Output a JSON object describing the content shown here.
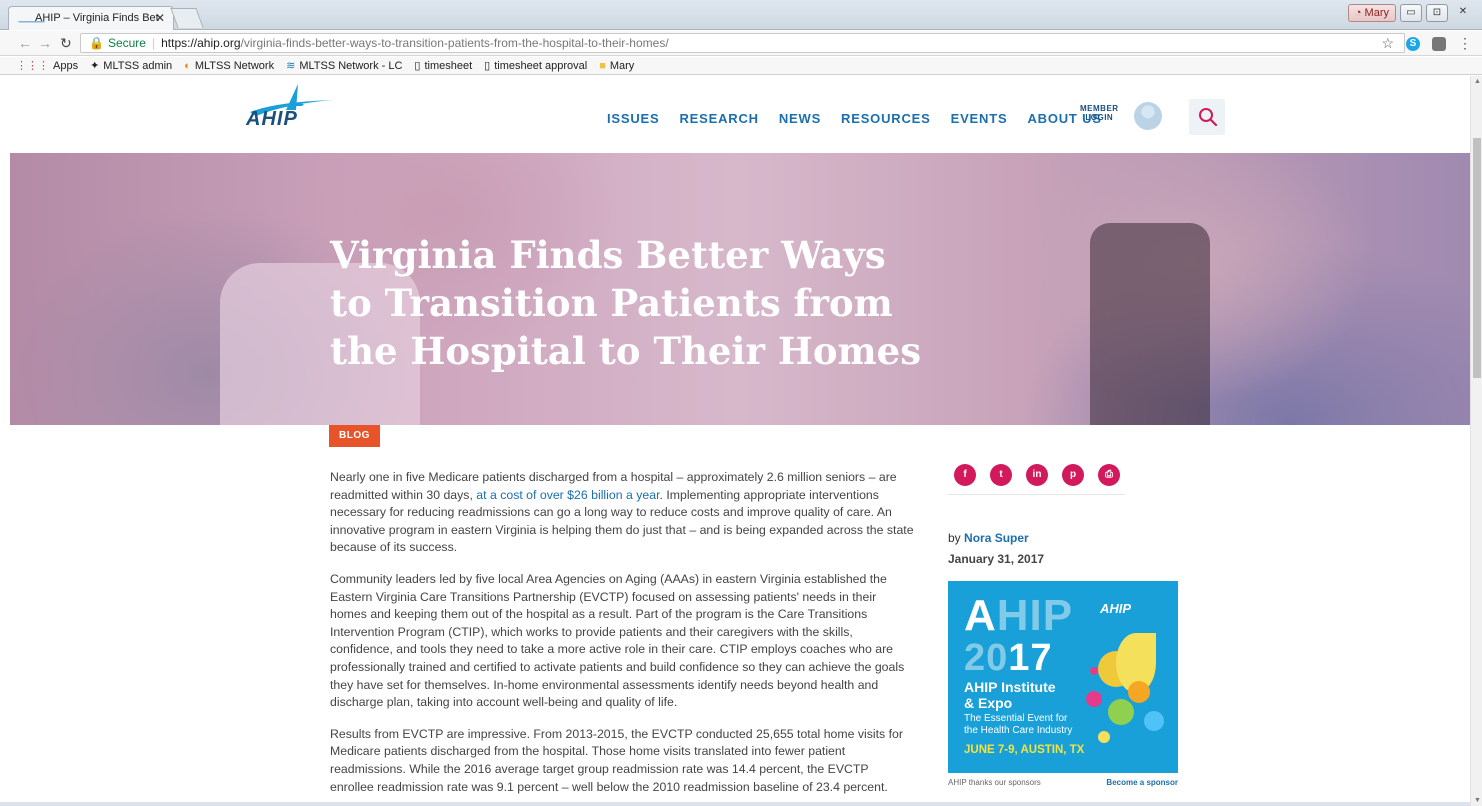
{
  "browser": {
    "tab_title": "AHIP – Virginia Finds Bet",
    "tab_close": "✕",
    "user_badge": "Mary",
    "win_min": "▭",
    "win_max": "⊡",
    "win_close": "✕",
    "secure_label": "Secure",
    "url_host": "https://ahip.org",
    "url_path": "/virginia-finds-better-ways-to-transition-patients-from-the-hospital-to-their-homes/",
    "bookmarks": [
      {
        "label": "Apps",
        "icon": "apps-grid-icon"
      },
      {
        "label": "MLTSS admin",
        "icon": "mltss-icon"
      },
      {
        "label": "MLTSS Network",
        "icon": "network-icon"
      },
      {
        "label": "MLTSS Network - LC",
        "icon": "network-icon"
      },
      {
        "label": "timesheet",
        "icon": "page-icon"
      },
      {
        "label": "timesheet approval",
        "icon": "page-icon"
      },
      {
        "label": "Mary",
        "icon": "folder-icon"
      }
    ]
  },
  "site": {
    "logo_text": "AHIP",
    "nav": [
      "ISSUES",
      "RESEARCH",
      "NEWS",
      "RESOURCES",
      "EVENTS",
      "ABOUT US"
    ],
    "member_line1": "MEMBER",
    "member_line2": "LOGIN"
  },
  "hero": {
    "title": "Virginia Finds Better Ways to Transition Patients from the Hospital to Their Homes"
  },
  "article": {
    "tag": "BLOG",
    "p1_before": "Nearly one in five Medicare patients discharged from a hospital – approximately 2.6 million seniors – are readmitted within 30 days, ",
    "p1_link": "at a cost of over $26 billion a year",
    "p1_after": ". Implementing appropriate interventions necessary for reducing readmissions can go a long way to reduce costs and improve quality of care.  An innovative program in eastern Virginia is helping them do just that – and is being expanded across the state because of its success.",
    "p2": "Community leaders led by five local Area Agencies on Aging (AAAs) in eastern Virginia established the Eastern Virginia Care Transitions Partnership (EVCTP) focused on assessing patients' needs in their homes and keeping them out of the hospital as a result. Part of the program is the Care Transitions Intervention Program (CTIP), which works to provide patients and their caregivers with the skills, confidence, and tools they need to take a more active role in their care. CTIP employs coaches who are professionally trained and certified to activate patients and build confidence so they can achieve the goals they have set for themselves. In-home environmental assessments identify needs beyond health and discharge plan, taking into account well-being and quality of life.",
    "p3": "Results from EVCTP are impressive. From 2013-2015, the EVCTP conducted 25,655 total home visits for Medicare patients discharged from the hospital. Those home visits translated into fewer patient readmissions. While the 2016 average target group readmission rate was 14.4 percent, the EVCTP enrollee readmission rate was 9.1 percent – well below the 2010 readmission baseline of 23.4 percent."
  },
  "sidebar": {
    "social": [
      {
        "glyph": "f",
        "icon": "facebook-icon"
      },
      {
        "glyph": "t",
        "icon": "twitter-icon"
      },
      {
        "glyph": "in",
        "icon": "linkedin-icon"
      },
      {
        "glyph": "p",
        "icon": "pinterest-icon"
      },
      {
        "glyph": "⎙",
        "icon": "print-icon"
      }
    ],
    "by": "by",
    "author": "Nora Super",
    "date": "January 31, 2017",
    "ad": {
      "logo_small": "AHIP",
      "big_a": "A",
      "big_hi": "HI",
      "big_p": "P",
      "year_20": "20",
      "year_1": "1",
      "year_7": "7",
      "inst_line1": "AHIP Institute",
      "inst_line2": "& Expo",
      "sub_line1": "The Essential Event for",
      "sub_line2": "the Health Care Industry",
      "dates": "JUNE 7-9, AUSTIN, TX"
    },
    "ad_thanks": "AHIP thanks our sponsors",
    "ad_become": "Become a sponsor"
  }
}
